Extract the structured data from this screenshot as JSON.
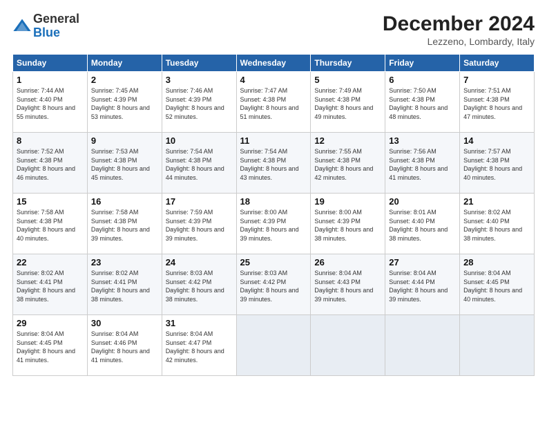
{
  "header": {
    "logo_general": "General",
    "logo_blue": "Blue",
    "month_title": "December 2024",
    "location": "Lezzeno, Lombardy, Italy"
  },
  "weekdays": [
    "Sunday",
    "Monday",
    "Tuesday",
    "Wednesday",
    "Thursday",
    "Friday",
    "Saturday"
  ],
  "weeks": [
    [
      {
        "day": "1",
        "sunrise": "7:44 AM",
        "sunset": "4:40 PM",
        "daylight": "8 hours and 55 minutes."
      },
      {
        "day": "2",
        "sunrise": "7:45 AM",
        "sunset": "4:39 PM",
        "daylight": "8 hours and 53 minutes."
      },
      {
        "day": "3",
        "sunrise": "7:46 AM",
        "sunset": "4:39 PM",
        "daylight": "8 hours and 52 minutes."
      },
      {
        "day": "4",
        "sunrise": "7:47 AM",
        "sunset": "4:38 PM",
        "daylight": "8 hours and 51 minutes."
      },
      {
        "day": "5",
        "sunrise": "7:49 AM",
        "sunset": "4:38 PM",
        "daylight": "8 hours and 49 minutes."
      },
      {
        "day": "6",
        "sunrise": "7:50 AM",
        "sunset": "4:38 PM",
        "daylight": "8 hours and 48 minutes."
      },
      {
        "day": "7",
        "sunrise": "7:51 AM",
        "sunset": "4:38 PM",
        "daylight": "8 hours and 47 minutes."
      }
    ],
    [
      {
        "day": "8",
        "sunrise": "7:52 AM",
        "sunset": "4:38 PM",
        "daylight": "8 hours and 46 minutes."
      },
      {
        "day": "9",
        "sunrise": "7:53 AM",
        "sunset": "4:38 PM",
        "daylight": "8 hours and 45 minutes."
      },
      {
        "day": "10",
        "sunrise": "7:54 AM",
        "sunset": "4:38 PM",
        "daylight": "8 hours and 44 minutes."
      },
      {
        "day": "11",
        "sunrise": "7:54 AM",
        "sunset": "4:38 PM",
        "daylight": "8 hours and 43 minutes."
      },
      {
        "day": "12",
        "sunrise": "7:55 AM",
        "sunset": "4:38 PM",
        "daylight": "8 hours and 42 minutes."
      },
      {
        "day": "13",
        "sunrise": "7:56 AM",
        "sunset": "4:38 PM",
        "daylight": "8 hours and 41 minutes."
      },
      {
        "day": "14",
        "sunrise": "7:57 AM",
        "sunset": "4:38 PM",
        "daylight": "8 hours and 40 minutes."
      }
    ],
    [
      {
        "day": "15",
        "sunrise": "7:58 AM",
        "sunset": "4:38 PM",
        "daylight": "8 hours and 40 minutes."
      },
      {
        "day": "16",
        "sunrise": "7:58 AM",
        "sunset": "4:38 PM",
        "daylight": "8 hours and 39 minutes."
      },
      {
        "day": "17",
        "sunrise": "7:59 AM",
        "sunset": "4:39 PM",
        "daylight": "8 hours and 39 minutes."
      },
      {
        "day": "18",
        "sunrise": "8:00 AM",
        "sunset": "4:39 PM",
        "daylight": "8 hours and 39 minutes."
      },
      {
        "day": "19",
        "sunrise": "8:00 AM",
        "sunset": "4:39 PM",
        "daylight": "8 hours and 38 minutes."
      },
      {
        "day": "20",
        "sunrise": "8:01 AM",
        "sunset": "4:40 PM",
        "daylight": "8 hours and 38 minutes."
      },
      {
        "day": "21",
        "sunrise": "8:02 AM",
        "sunset": "4:40 PM",
        "daylight": "8 hours and 38 minutes."
      }
    ],
    [
      {
        "day": "22",
        "sunrise": "8:02 AM",
        "sunset": "4:41 PM",
        "daylight": "8 hours and 38 minutes."
      },
      {
        "day": "23",
        "sunrise": "8:02 AM",
        "sunset": "4:41 PM",
        "daylight": "8 hours and 38 minutes."
      },
      {
        "day": "24",
        "sunrise": "8:03 AM",
        "sunset": "4:42 PM",
        "daylight": "8 hours and 38 minutes."
      },
      {
        "day": "25",
        "sunrise": "8:03 AM",
        "sunset": "4:42 PM",
        "daylight": "8 hours and 39 minutes."
      },
      {
        "day": "26",
        "sunrise": "8:04 AM",
        "sunset": "4:43 PM",
        "daylight": "8 hours and 39 minutes."
      },
      {
        "day": "27",
        "sunrise": "8:04 AM",
        "sunset": "4:44 PM",
        "daylight": "8 hours and 39 minutes."
      },
      {
        "day": "28",
        "sunrise": "8:04 AM",
        "sunset": "4:45 PM",
        "daylight": "8 hours and 40 minutes."
      }
    ],
    [
      {
        "day": "29",
        "sunrise": "8:04 AM",
        "sunset": "4:45 PM",
        "daylight": "8 hours and 41 minutes."
      },
      {
        "day": "30",
        "sunrise": "8:04 AM",
        "sunset": "4:46 PM",
        "daylight": "8 hours and 41 minutes."
      },
      {
        "day": "31",
        "sunrise": "8:04 AM",
        "sunset": "4:47 PM",
        "daylight": "8 hours and 42 minutes."
      },
      null,
      null,
      null,
      null
    ]
  ]
}
